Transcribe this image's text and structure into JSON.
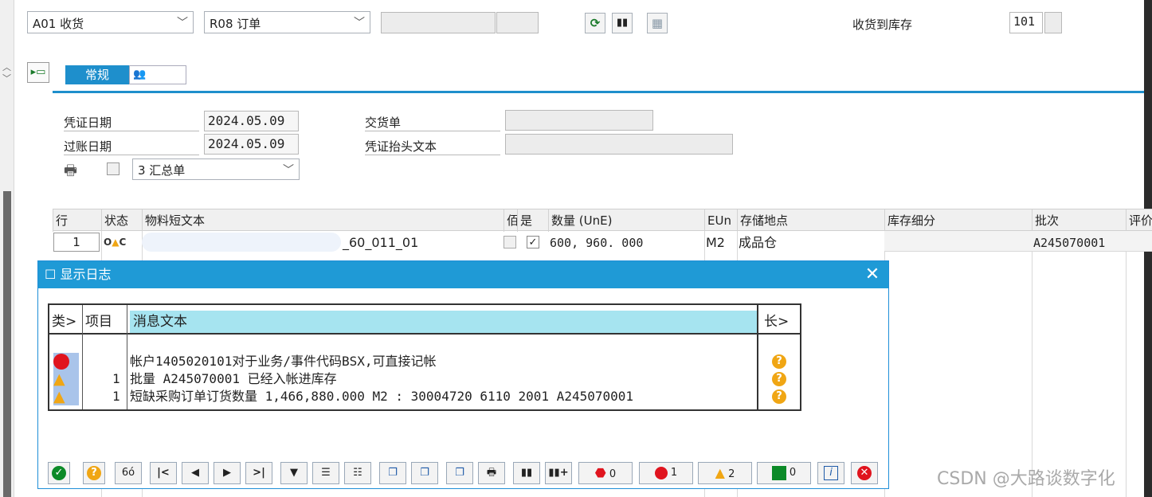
{
  "toolbar": {
    "action": "A01 收货",
    "reference": "R08 订单",
    "movement_label": "收货到库存",
    "movement_type": "101"
  },
  "tabs": {
    "general": "常规"
  },
  "header": {
    "doc_date_label": "凭证日期",
    "doc_date": "2024.05.09",
    "post_date_label": "过账日期",
    "post_date": "2024.05.09",
    "delivery_label": "交货单",
    "header_text_label": "凭证抬头文本",
    "print_version": "3 汇总单"
  },
  "grid": {
    "columns": [
      "行",
      "状态",
      "物料短文本",
      "",
      "是",
      "数量 (UnE)",
      "EUn",
      "存储地点",
      "库存细分",
      "批次",
      "评价"
    ],
    "row": {
      "line": "1",
      "material_text": "_60_011_01",
      "ok": "✓",
      "quantity": "600, 960. 000",
      "unit": "M2",
      "storage": "成品仓",
      "batch": "A245070001"
    }
  },
  "dialog": {
    "title": "显示日志",
    "headers": {
      "type": "类>",
      "item": "项目",
      "text": "消息文本",
      "long": "长>"
    },
    "messages": [
      {
        "type": "error",
        "item": "",
        "text": "帐户1405020101对于业务/事件代码BSX,可直接记帐"
      },
      {
        "type": "warning",
        "item": "1",
        "text": "批量 A245070001 已经入帐进库存"
      },
      {
        "type": "warning",
        "item": "1",
        "text": "短缺采购订单订货数量 1,466,880.000 M2 : 30004720 6110 2001 A245070001"
      }
    ],
    "counts": {
      "stop": "0",
      "error": "1",
      "warning": "2",
      "success": "0"
    }
  },
  "watermark": "CSDN @大路谈数字化",
  "colors": {
    "title_bar": "#1f9ad6",
    "header_cyan": "#a6e4f0",
    "error_red": "#e0141e",
    "warning_orange": "#f0a614",
    "success_green": "#0c8a28"
  }
}
